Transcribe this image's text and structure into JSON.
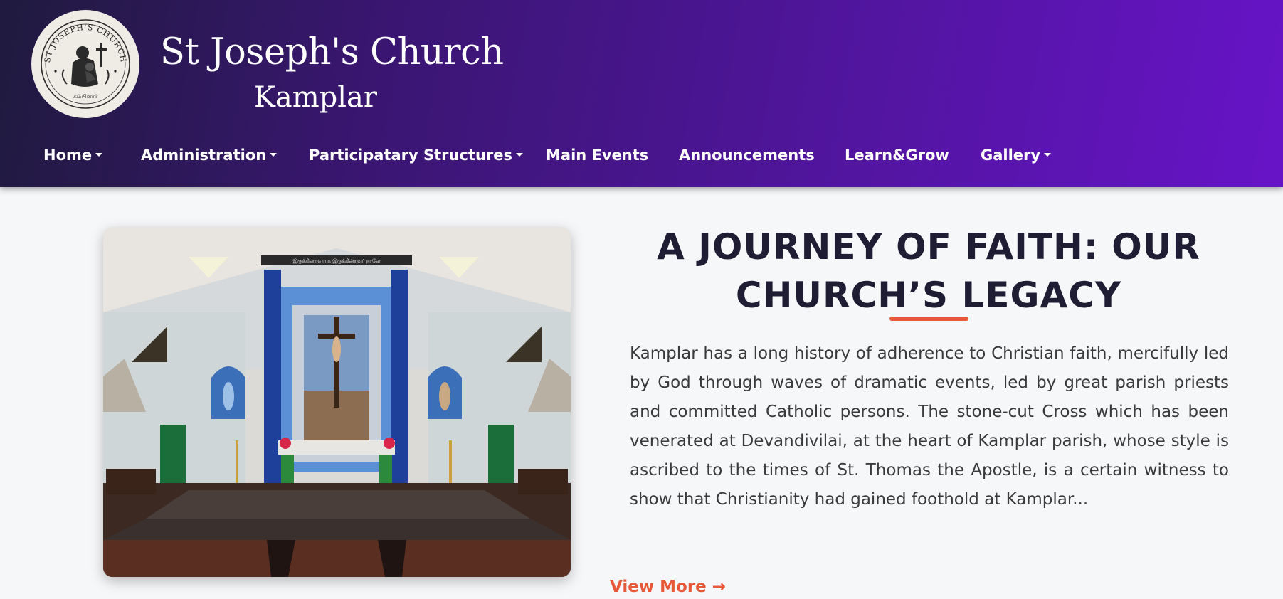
{
  "header": {
    "title": "St Joseph's Church",
    "subtitle": "Kamplar",
    "logo_text_top": "ST JOSEPH'S CHURCH",
    "logo_text_bottom": "கம்பிளார்",
    "gradient_start": "#1f1a3e",
    "gradient_end": "#6714c7"
  },
  "nav": {
    "items": [
      {
        "label": "Home",
        "dropdown": true
      },
      {
        "label": "Administration",
        "dropdown": true
      },
      {
        "label": "Participatary Structures",
        "dropdown": true
      },
      {
        "label": "Main Events",
        "dropdown": false
      },
      {
        "label": "Announcements",
        "dropdown": false
      },
      {
        "label": "Learn&Grow",
        "dropdown": false
      },
      {
        "label": "Gallery",
        "dropdown": true
      }
    ]
  },
  "main": {
    "image_banner_text": "இருக்கின்றவராக இருக்கின்றவர் நானே",
    "heading": "A JOURNEY OF FAITH: OUR CHURCH’S LEGACY",
    "paragraph": "Kamplar has a long history of adherence to Christian faith, mercifully led by God through waves of dramatic events, led by great parish priests and committed Catholic persons. The stone-cut Cross which has been venerated at Devandivilai, at the heart of Kamplar parish, whose style is ascribed to the times of St. Thomas the Apostle, is a certain witness to show that Christianity had gained foothold at Kamplar...",
    "view_more": "View More →",
    "accent_color": "#e8593a"
  }
}
